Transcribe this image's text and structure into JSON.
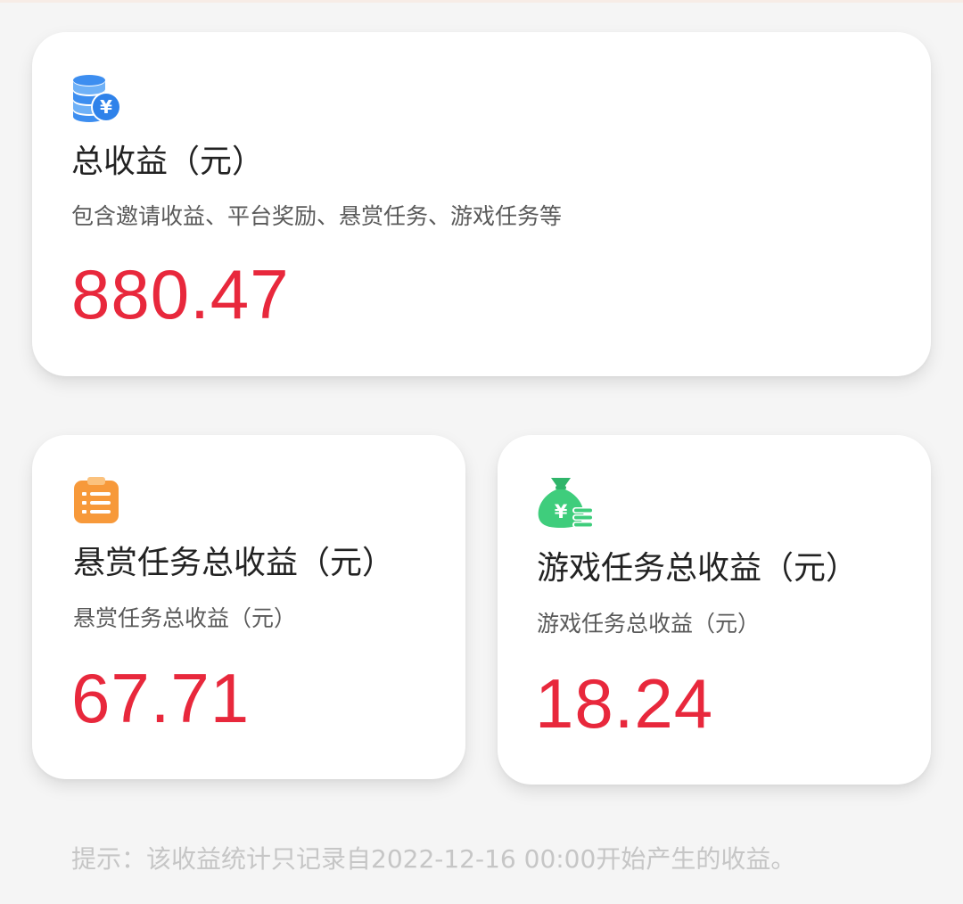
{
  "cards": [
    {
      "icon": "coin-stack-yen-icon",
      "title": "总收益（元）",
      "description": "包含邀请收益、平台奖励、悬赏任务、游戏任务等",
      "amount": "880.47"
    },
    {
      "icon": "clipboard-list-icon",
      "title": "悬赏任务总收益（元）",
      "description": "悬赏任务总收益（元）",
      "amount": "67.71"
    },
    {
      "icon": "money-bag-yen-icon",
      "title": "游戏任务总收益（元）",
      "description": "游戏任务总收益（元）",
      "amount": "18.24"
    }
  ],
  "hint": "提示：该收益统计只记录自2022-12-16 00:00开始产生的收益。",
  "colors": {
    "amount": "#e8283c",
    "coin_icon": "#3d8ef0",
    "clipboard_icon": "#f7993a",
    "money_bag_icon": "#3fcd7c"
  }
}
